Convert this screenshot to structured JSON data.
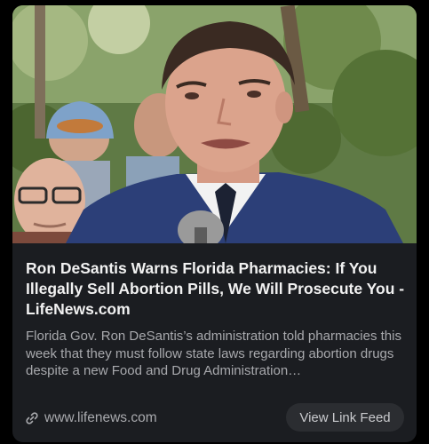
{
  "article": {
    "title": "Ron DeSantis Warns Florida Pharmacies: If You Illegally Sell Abortion Pills, We Will Prosecute You - LifeNews.com",
    "description": "Florida Gov. Ron DeSantis’s administration told pharmacies this week that they must follow state laws regarding abortion drugs despite a new Food and Drug Administration…",
    "link_icon": "link-icon",
    "domain": "www.lifenews.com",
    "button_label": "View Link Feed"
  },
  "colors": {
    "page_background": "#000000",
    "card_background": "#1b1d21",
    "title_text": "#f1f1f1",
    "secondary_text": "#a8a9ad",
    "button_background": "#2b2d31"
  }
}
